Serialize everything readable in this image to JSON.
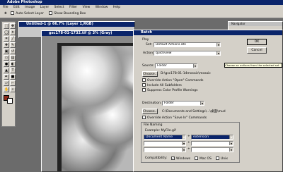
{
  "app": {
    "title": "Adobe Photoshop"
  },
  "menu": [
    "File",
    "Edit",
    "Image",
    "Layer",
    "Select",
    "Filter",
    "View",
    "Window",
    "Help"
  ],
  "options": {
    "auto_select": "Auto Select Layer",
    "bounding": "Show Bounding Box"
  },
  "doc1": {
    "title": "Untitled-1 @ 66.7% (Layer 1,RGB)"
  },
  "doc2": {
    "title": "gsc178-01-1732.tif @ 3% (Gray)"
  },
  "navigator": {
    "tab": "Navigator"
  },
  "batch": {
    "title": "Batch",
    "play_label": "Play",
    "set_label": "Set:",
    "set_value": "Default Actions.atn",
    "action_label": "Action:",
    "action_value": "quickview",
    "source_label": "Source:",
    "source_value": "Folder",
    "choose_label": "Choose...",
    "source_path": "D:\\gsc178-01-14mosaic\\mosaic",
    "source_hint": "Choose an actions from the selected set",
    "override_open": "Override Action \"Open\" Commands",
    "include_sub": "Include All Subfolders",
    "suppress": "Suppress Color Profile Warnings",
    "dest_label": "Destination:",
    "dest_value": "Folder",
    "dest_path": "C:\\Documents and Settings\\...\\桌面\\mud",
    "override_save": "Override Action \"Save In\" Commands",
    "file_naming": "File Naming",
    "example": "Example: MyFile.gif",
    "name1": "Document Name",
    "name2": "extension",
    "compat": "Compatibility:",
    "windows": "Windows",
    "macos": "Mac OS",
    "unix": "Unix",
    "ok": "OK",
    "cancel": "Cancel"
  }
}
